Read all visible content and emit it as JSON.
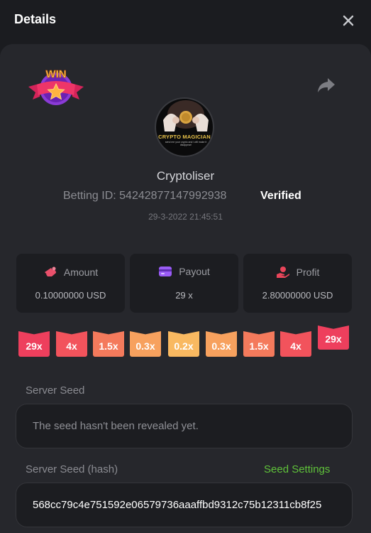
{
  "header": {
    "title": "Details"
  },
  "bet": {
    "username": "Cryptoliser",
    "betting_id_label": "Betting ID:",
    "betting_id": "54242877147992938",
    "verified": "Verified",
    "timestamp": "29-3-2022 21:45:51",
    "badge_text": "WIN",
    "avatar_title": "CRYPTO MAGICIAN",
    "avatar_subtitle": "send me your crypto and i will make it disappear!"
  },
  "stats": [
    {
      "label": "Amount",
      "value": "0.10000000 USD",
      "icon": "amount-icon",
      "color": "#e9506b"
    },
    {
      "label": "Payout",
      "value": "29 x",
      "icon": "card-icon",
      "color": "#9a5cf5"
    },
    {
      "label": "Profit",
      "value": "2.80000000 USD",
      "icon": "hand-coin-icon",
      "color": "#e9455a"
    }
  ],
  "multipliers": [
    {
      "label": "29x",
      "color": "#ee3f5d"
    },
    {
      "label": "4x",
      "color": "#f2535c"
    },
    {
      "label": "1.5x",
      "color": "#f47a5c"
    },
    {
      "label": "0.3x",
      "color": "#f7a15e"
    },
    {
      "label": "0.2x",
      "color": "#f9b961"
    },
    {
      "label": "0.3x",
      "color": "#f7a15e"
    },
    {
      "label": "1.5x",
      "color": "#f47a5c"
    },
    {
      "label": "4x",
      "color": "#f2535c"
    },
    {
      "label": "29x",
      "color": "#ee3f5d"
    }
  ],
  "server_seed": {
    "label": "Server Seed",
    "value": "The seed hasn't been revealed yet."
  },
  "server_seed_hash": {
    "label": "Server Seed (hash)",
    "link": "Seed Settings",
    "value": "568cc79c4e751592e06579736aaaffbd9312c75b12311cb8f25"
  }
}
